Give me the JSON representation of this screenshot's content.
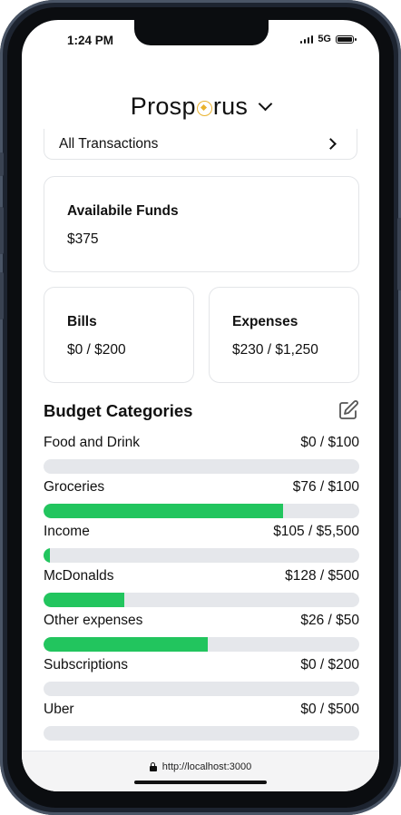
{
  "status": {
    "time": "1:24 PM",
    "network": "5G"
  },
  "header": {
    "brand_prefix": "Prosp",
    "brand_suffix": "rus"
  },
  "transactions_link": {
    "label": "All Transactions"
  },
  "funds": {
    "title": "Availabile Funds",
    "value": "$375"
  },
  "bills": {
    "title": "Bills",
    "value": "$0 / $200"
  },
  "expenses": {
    "title": "Expenses",
    "value": "$230 / $1,250"
  },
  "categories": {
    "title": "Budget Categories",
    "items": [
      {
        "name": "Food and Drink",
        "amount": "$0 / $100",
        "progress": 0
      },
      {
        "name": "Groceries",
        "amount": "$76 / $100",
        "progress": 0.76
      },
      {
        "name": "Income",
        "amount": "$105 / $5,500",
        "progress": 0.019
      },
      {
        "name": "McDonalds",
        "amount": "$128 / $500",
        "progress": 0.256
      },
      {
        "name": "Other expenses",
        "amount": "$26 / $50",
        "progress": 0.52
      },
      {
        "name": "Subscriptions",
        "amount": "$0 / $200",
        "progress": 0
      },
      {
        "name": "Uber",
        "amount": "$0 / $500",
        "progress": 0
      }
    ]
  },
  "browser": {
    "url": "http://localhost:3000"
  },
  "colors": {
    "accent": "#22c55e",
    "track": "#e5e7eb",
    "logo_accent": "#e9b22d"
  }
}
